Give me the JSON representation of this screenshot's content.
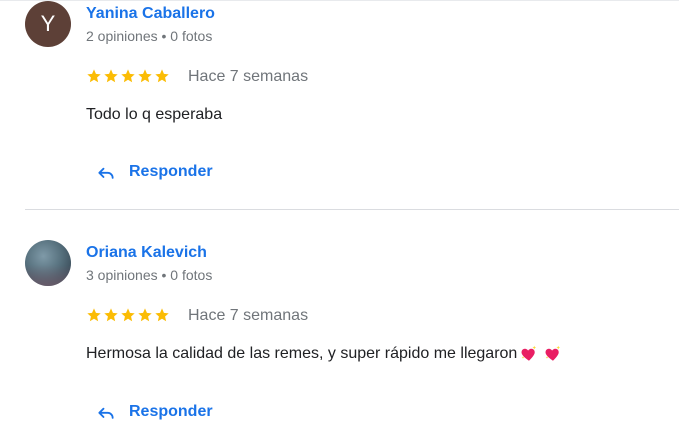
{
  "reviews": [
    {
      "avatar_letter": "Y",
      "avatar_color": "#5d4037",
      "name": "Yanina Caballero",
      "meta": "2 opiniones • 0 fotos",
      "rating": 5,
      "time": "Hace 7 semanas",
      "text": "Todo lo q esperaba",
      "emojis": [],
      "reply_label": "Responder"
    },
    {
      "avatar_letter": "",
      "name": "Oriana Kalevich",
      "meta": "3 opiniones • 0 fotos",
      "rating": 5,
      "time": "Hace 7 semanas",
      "text": "Hermosa la calidad de las remes, y super rápido me llegaron",
      "emojis": [
        "sparkling-heart-icon",
        "sparkling-heart-icon"
      ],
      "reply_label": "Responder"
    }
  ],
  "colors": {
    "link": "#1a73e8",
    "star": "#fbbc04",
    "meta": "#70757a",
    "text": "#202124"
  }
}
